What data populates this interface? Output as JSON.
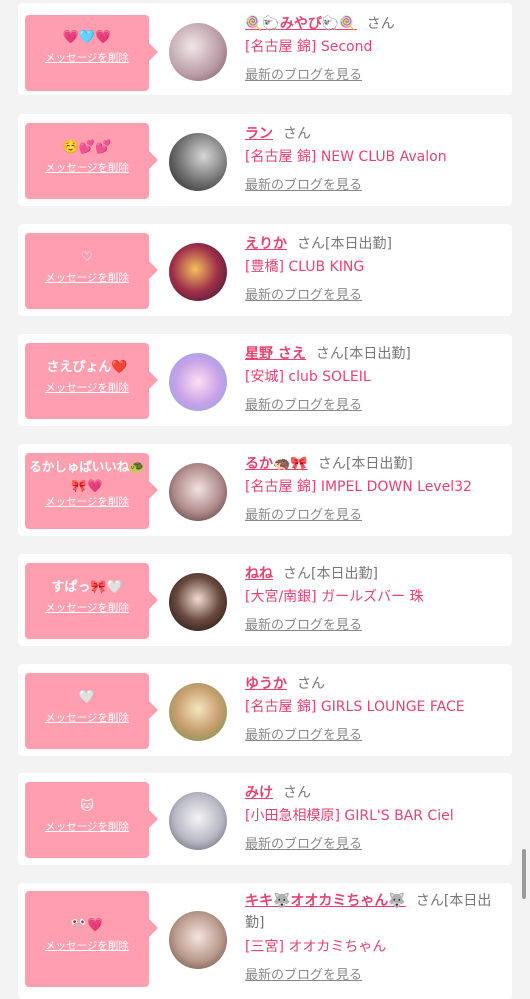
{
  "delete_label": "メッセージを削除",
  "blog_label": "最新のブログを見る",
  "cards": [
    {
      "message": "💗🩵💗",
      "name": "🍭🐑みやび🐑🍭",
      "suffix": "さん",
      "shop": "[名古屋 錦] Second"
    },
    {
      "message": "☺️💕💕",
      "name": "ラン",
      "suffix": "さん",
      "shop": "[名古屋 錦] NEW CLUB Avalon"
    },
    {
      "message": "♡",
      "name": "えりか",
      "suffix": "さん[本日出勤]",
      "shop": "[豊橋] CLUB KING"
    },
    {
      "message": "さえぴょん❤️",
      "name": "星野 さえ",
      "suffix": "さん[本日出勤]",
      "shop": "[安城] club SOLEIL"
    },
    {
      "message": "るかしゅぱいいね🐢🎀💗",
      "name": "るか🦔🎀",
      "suffix": "さん[本日出勤]",
      "shop": "[名古屋 錦] IMPEL DOWN Level32"
    },
    {
      "message": "すぱっ🎀🤍",
      "name": "ねね",
      "suffix": "さん[本日出勤]",
      "shop": "[大宮/南銀] ガールズバー 珠"
    },
    {
      "message": "🤍",
      "name": "ゆうか",
      "suffix": "さん",
      "shop": "[名古屋 錦] GIRLS LOUNGE FACE"
    },
    {
      "message": "🐱",
      "name": "みけ",
      "suffix": "さん",
      "shop": "[小田急相模原] GIRL'S BAR Ciel"
    },
    {
      "message": "🎌💗",
      "name": "キキ🐺オオカミちゃん🐺",
      "suffix": "さん[本日出勤]",
      "shop": "[三宮] オオカミちゃん"
    }
  ],
  "colors": {
    "bubble": "#ff9eaf",
    "name": "#e8426f",
    "background": "#f3f3f3"
  }
}
